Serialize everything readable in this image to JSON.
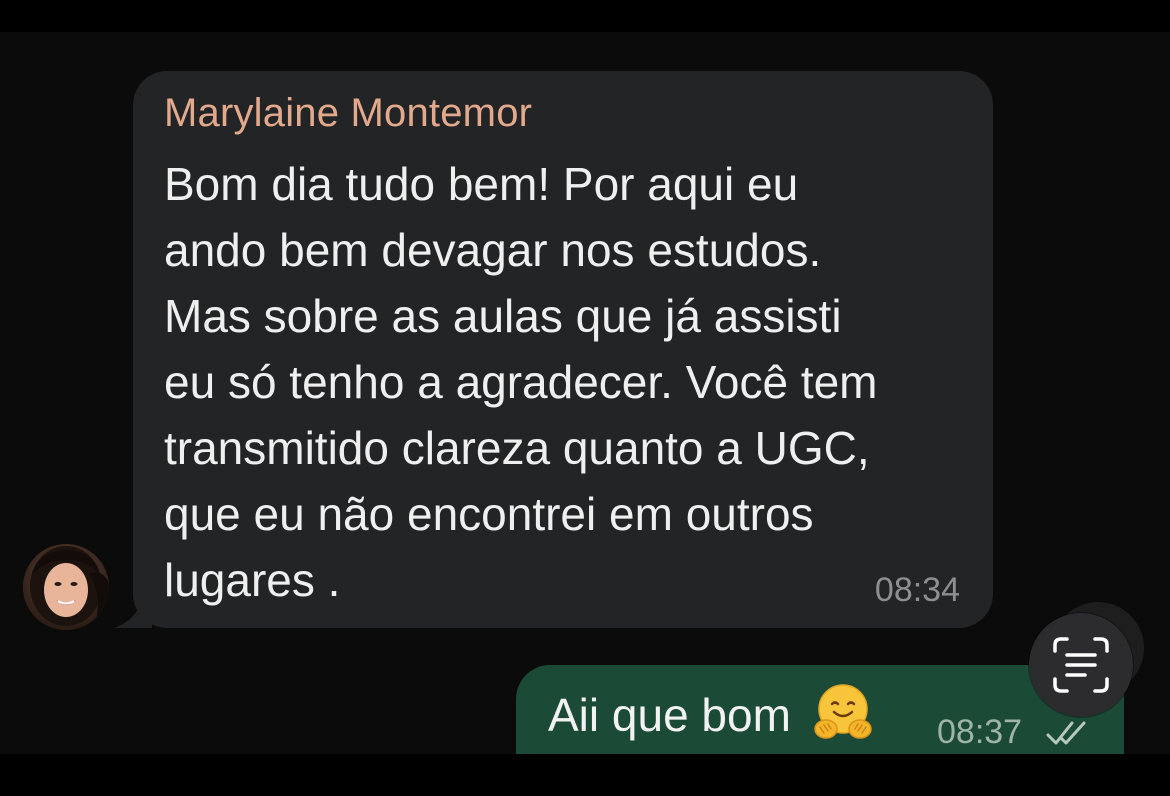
{
  "incoming_message": {
    "sender": "Marylaine Montemor",
    "lines": [
      "Bom dia tudo bem! Por aqui eu",
      "ando bem devagar nos estudos.",
      "Mas sobre as aulas que já assisti",
      "eu só tenho a agradecer. Você tem",
      "transmitido clareza quanto a UGC,",
      "que eu não encontrei em outros",
      "lugares ."
    ],
    "time": "08:34",
    "avatar_icon": "user-avatar"
  },
  "outgoing_message": {
    "text": "Aii que bom",
    "emoji_icon": "hugging-face-emoji",
    "time": "08:37",
    "status_icon": "double-check-read-icon"
  },
  "live_text_button": {
    "icon": "live-text-scan-icon"
  },
  "colors": {
    "background": "#0b0b0b",
    "incoming_bubble": "#232425",
    "outgoing_bubble": "#1b4a36",
    "sender_name": "#e2a98d",
    "message_text": "#efefef",
    "timestamp": "#8d8f91"
  }
}
